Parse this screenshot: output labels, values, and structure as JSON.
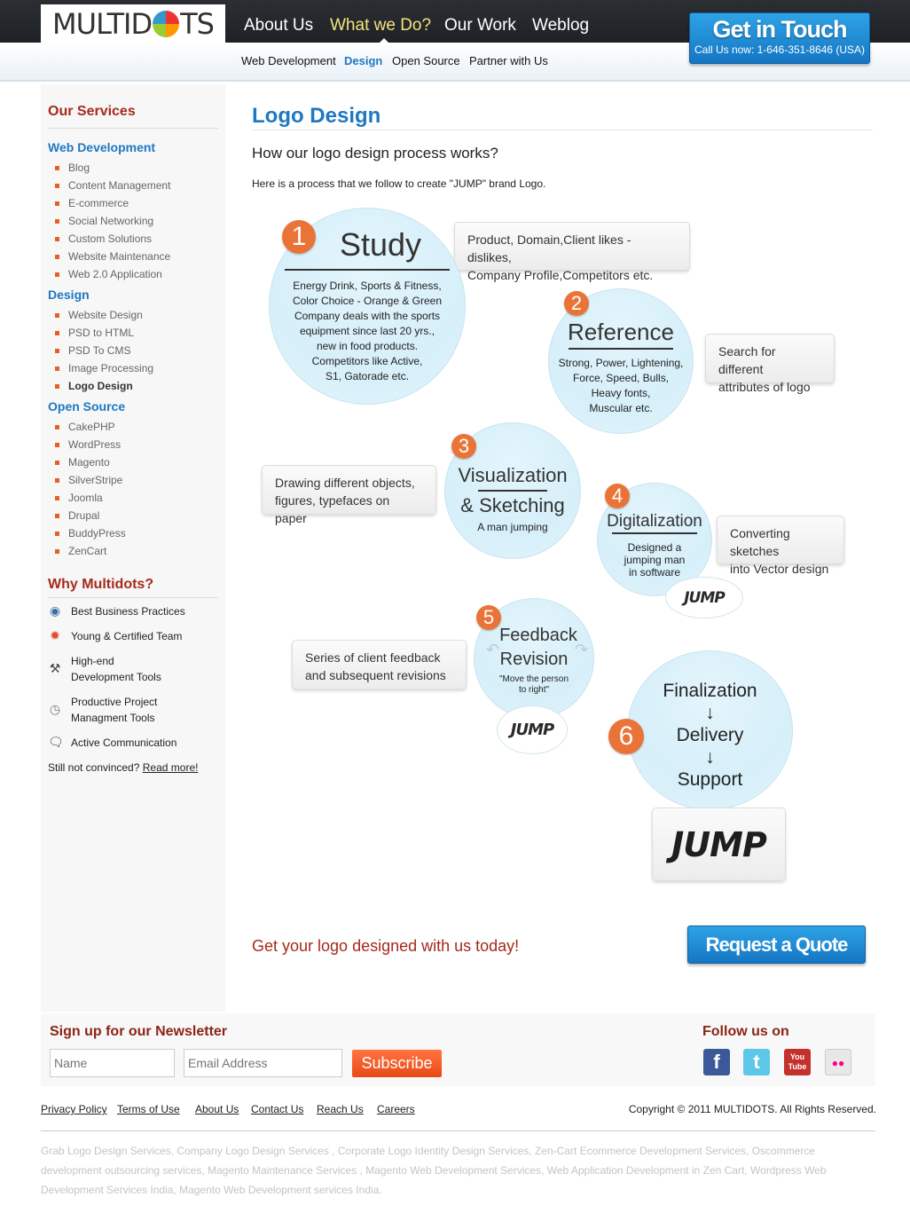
{
  "header": {
    "logo_text": "MULTIDOTS",
    "main_nav": [
      "About Us",
      "What we Do?",
      "Our Work",
      "Weblog"
    ],
    "active_main": "What we Do?",
    "sub_nav": [
      "Web Development",
      "Design",
      "Open Source",
      "Partner with Us"
    ],
    "active_sub": "Design",
    "cta_title": "Get in Touch",
    "cta_sub": "Call Us now: 1-646-351-8646 (USA)"
  },
  "sidebar": {
    "services_title": "Our Services",
    "categories": [
      {
        "label": "Web Development",
        "items": [
          "Blog",
          "Content Management",
          "E-commerce",
          "Social Networking",
          "Custom Solutions",
          "Website Maintenance",
          "Web 2.0 Application"
        ]
      },
      {
        "label": "Design",
        "items": [
          "Website Design",
          "PSD to HTML",
          "PSD To CMS",
          "Image Processing",
          "Logo Design"
        ]
      },
      {
        "label": "Open Source",
        "items": [
          "CakePHP",
          "WordPress",
          "Magento",
          "SilverStripe",
          "Joomla",
          "Drupal",
          "BuddyPress",
          "ZenCart"
        ]
      }
    ],
    "active_item": "Logo Design",
    "why_title": "Why Multidots?",
    "why_items": [
      {
        "icon": "award-icon",
        "label1": "Best Business Practices",
        "label2": ""
      },
      {
        "icon": "ribbon-icon",
        "label1": "Young & Certified Team",
        "label2": ""
      },
      {
        "icon": "tools-icon",
        "label1": "High-end",
        "label2": "Development Tools"
      },
      {
        "icon": "clock-icon",
        "label1": "Productive Project",
        "label2": "Managment Tools"
      },
      {
        "icon": "chat-icon",
        "label1": "Active Communication",
        "label2": ""
      }
    ],
    "convince_text": "Still not convinced?",
    "read_more": "Read more!"
  },
  "main": {
    "title": "Logo Design",
    "subtitle": "How our logo design process works?",
    "intro": "Here is a process that we follow to create \"JUMP\" brand Logo.",
    "steps": [
      {
        "num": "1",
        "title": "Study",
        "text": [
          "Energy Drink, Sports & Fitness,",
          "Color Choice - Orange & Green",
          "Company deals with the sports",
          "equipment since last 20 yrs.,",
          "new in food products.",
          "Competitors like Active,",
          "S1, Gatorade etc."
        ],
        "callout": [
          "Product, Domain,Client likes - dislikes,",
          "Company Profile,Competitors etc."
        ]
      },
      {
        "num": "2",
        "title": "Reference",
        "text": [
          "Strong, Power, Lightening,",
          "Force, Speed, Bulls,",
          "Heavy fonts,",
          "Muscular etc."
        ],
        "callout": [
          "Search for different",
          "attributes of logo"
        ]
      },
      {
        "num": "3",
        "title": "Visualization",
        "title2": "& Sketching",
        "text": [
          "A man jumping"
        ],
        "callout": [
          "Drawing different objects,",
          "figures, typefaces on paper"
        ]
      },
      {
        "num": "4",
        "title": "Digitalization",
        "text": [
          "Designed a",
          "jumping man",
          "in software"
        ],
        "callout": [
          "Converting sketches",
          "into Vector design"
        ]
      },
      {
        "num": "5",
        "title": "Feedback",
        "title2": "Revision",
        "text": [
          "\"Move the person",
          "to right\""
        ],
        "callout": [
          "Series of client feedback",
          "and subsequent revisions"
        ]
      },
      {
        "num": "6",
        "lines": [
          "Finalization",
          "↓",
          "Delivery",
          "↓",
          "Support"
        ]
      }
    ],
    "logo_word": "JUMP",
    "cta_text": "Get your logo designed with us today!",
    "quote_button": "Request a Quote"
  },
  "footer": {
    "newsletter_title": "Sign up for our Newsletter",
    "name_placeholder": "Name",
    "email_placeholder": "Email Address",
    "subscribe": "Subscribe",
    "follow_title": "Follow us on",
    "social": [
      {
        "name": "facebook",
        "glyph": "f",
        "color": "#3b5998"
      },
      {
        "name": "twitter",
        "glyph": "t",
        "color": "#5ec6e8"
      },
      {
        "name": "youtube",
        "glyph": "You Tube",
        "color": "#c4302b"
      },
      {
        "name": "flickr",
        "glyph": "●●",
        "color": "#e8e8e8"
      }
    ],
    "links": [
      "Privacy Policy",
      "Terms of Use",
      "About Us",
      "Contact Us",
      "Reach Us",
      "Careers"
    ],
    "copyright": "Copyright © 2011 MULTIDOTS. All Rights Reserved.",
    "seo_text": "Grab Logo Design Services, Company Logo Design Services , Corporate Logo Identity Design Services, Zen-Cart Ecommerce Development Services, Oscommerce development outsourcing services, Magento Maintenance Services , Magento Web Development Services, Web Application Development in Zen Cart, Wordpress Web Development Services India, Magento Web Development services India."
  }
}
